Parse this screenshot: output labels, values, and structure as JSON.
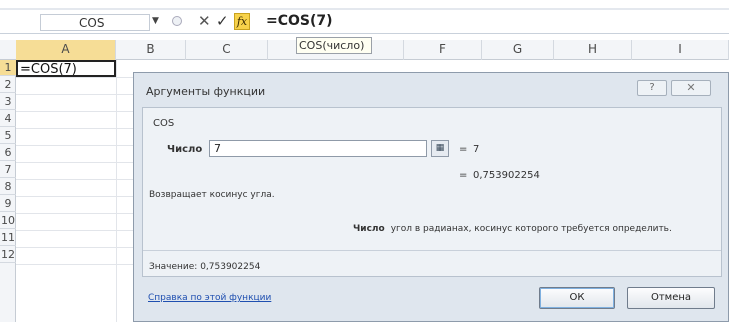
{
  "formula_bar": {
    "name_box_value": "COS",
    "cancel_icon": "✕",
    "enter_icon": "✓",
    "fx_label": "fx",
    "formula": "=COS(7)"
  },
  "tooltip": "COS(число)",
  "grid": {
    "columns": [
      "A",
      "B",
      "C",
      "D",
      "F",
      "G",
      "H",
      "I"
    ],
    "rows": [
      "1",
      "2",
      "3",
      "4",
      "5",
      "6",
      "7",
      "8",
      "9",
      "10",
      "11",
      "12"
    ],
    "active_cell_value": "=COS(7)"
  },
  "dialog": {
    "title": "Аргументы функции",
    "help_icon": "?",
    "close_icon": "✕",
    "function_name": "COS",
    "argument_label": "Число",
    "argument_value": "7",
    "argument_equals": "=",
    "argument_evaluated": "7",
    "result_equals": "=",
    "result_evaluated": "0,753902254",
    "description": "Возвращает косинус угла.",
    "argument_help_name": "Число",
    "argument_help_text": "угол в радианах, косинус которого требуется определить.",
    "value_line": "Значение:  0,753902254",
    "help_link": "Справка по этой функции",
    "ok_label": "ОК",
    "cancel_label": "Отмена"
  },
  "colors": {
    "selected_header": "#f6dd96",
    "dialog_bg": "#dfe6ee",
    "link": "#1f4fb0",
    "fx_button": "#f7d24a"
  }
}
